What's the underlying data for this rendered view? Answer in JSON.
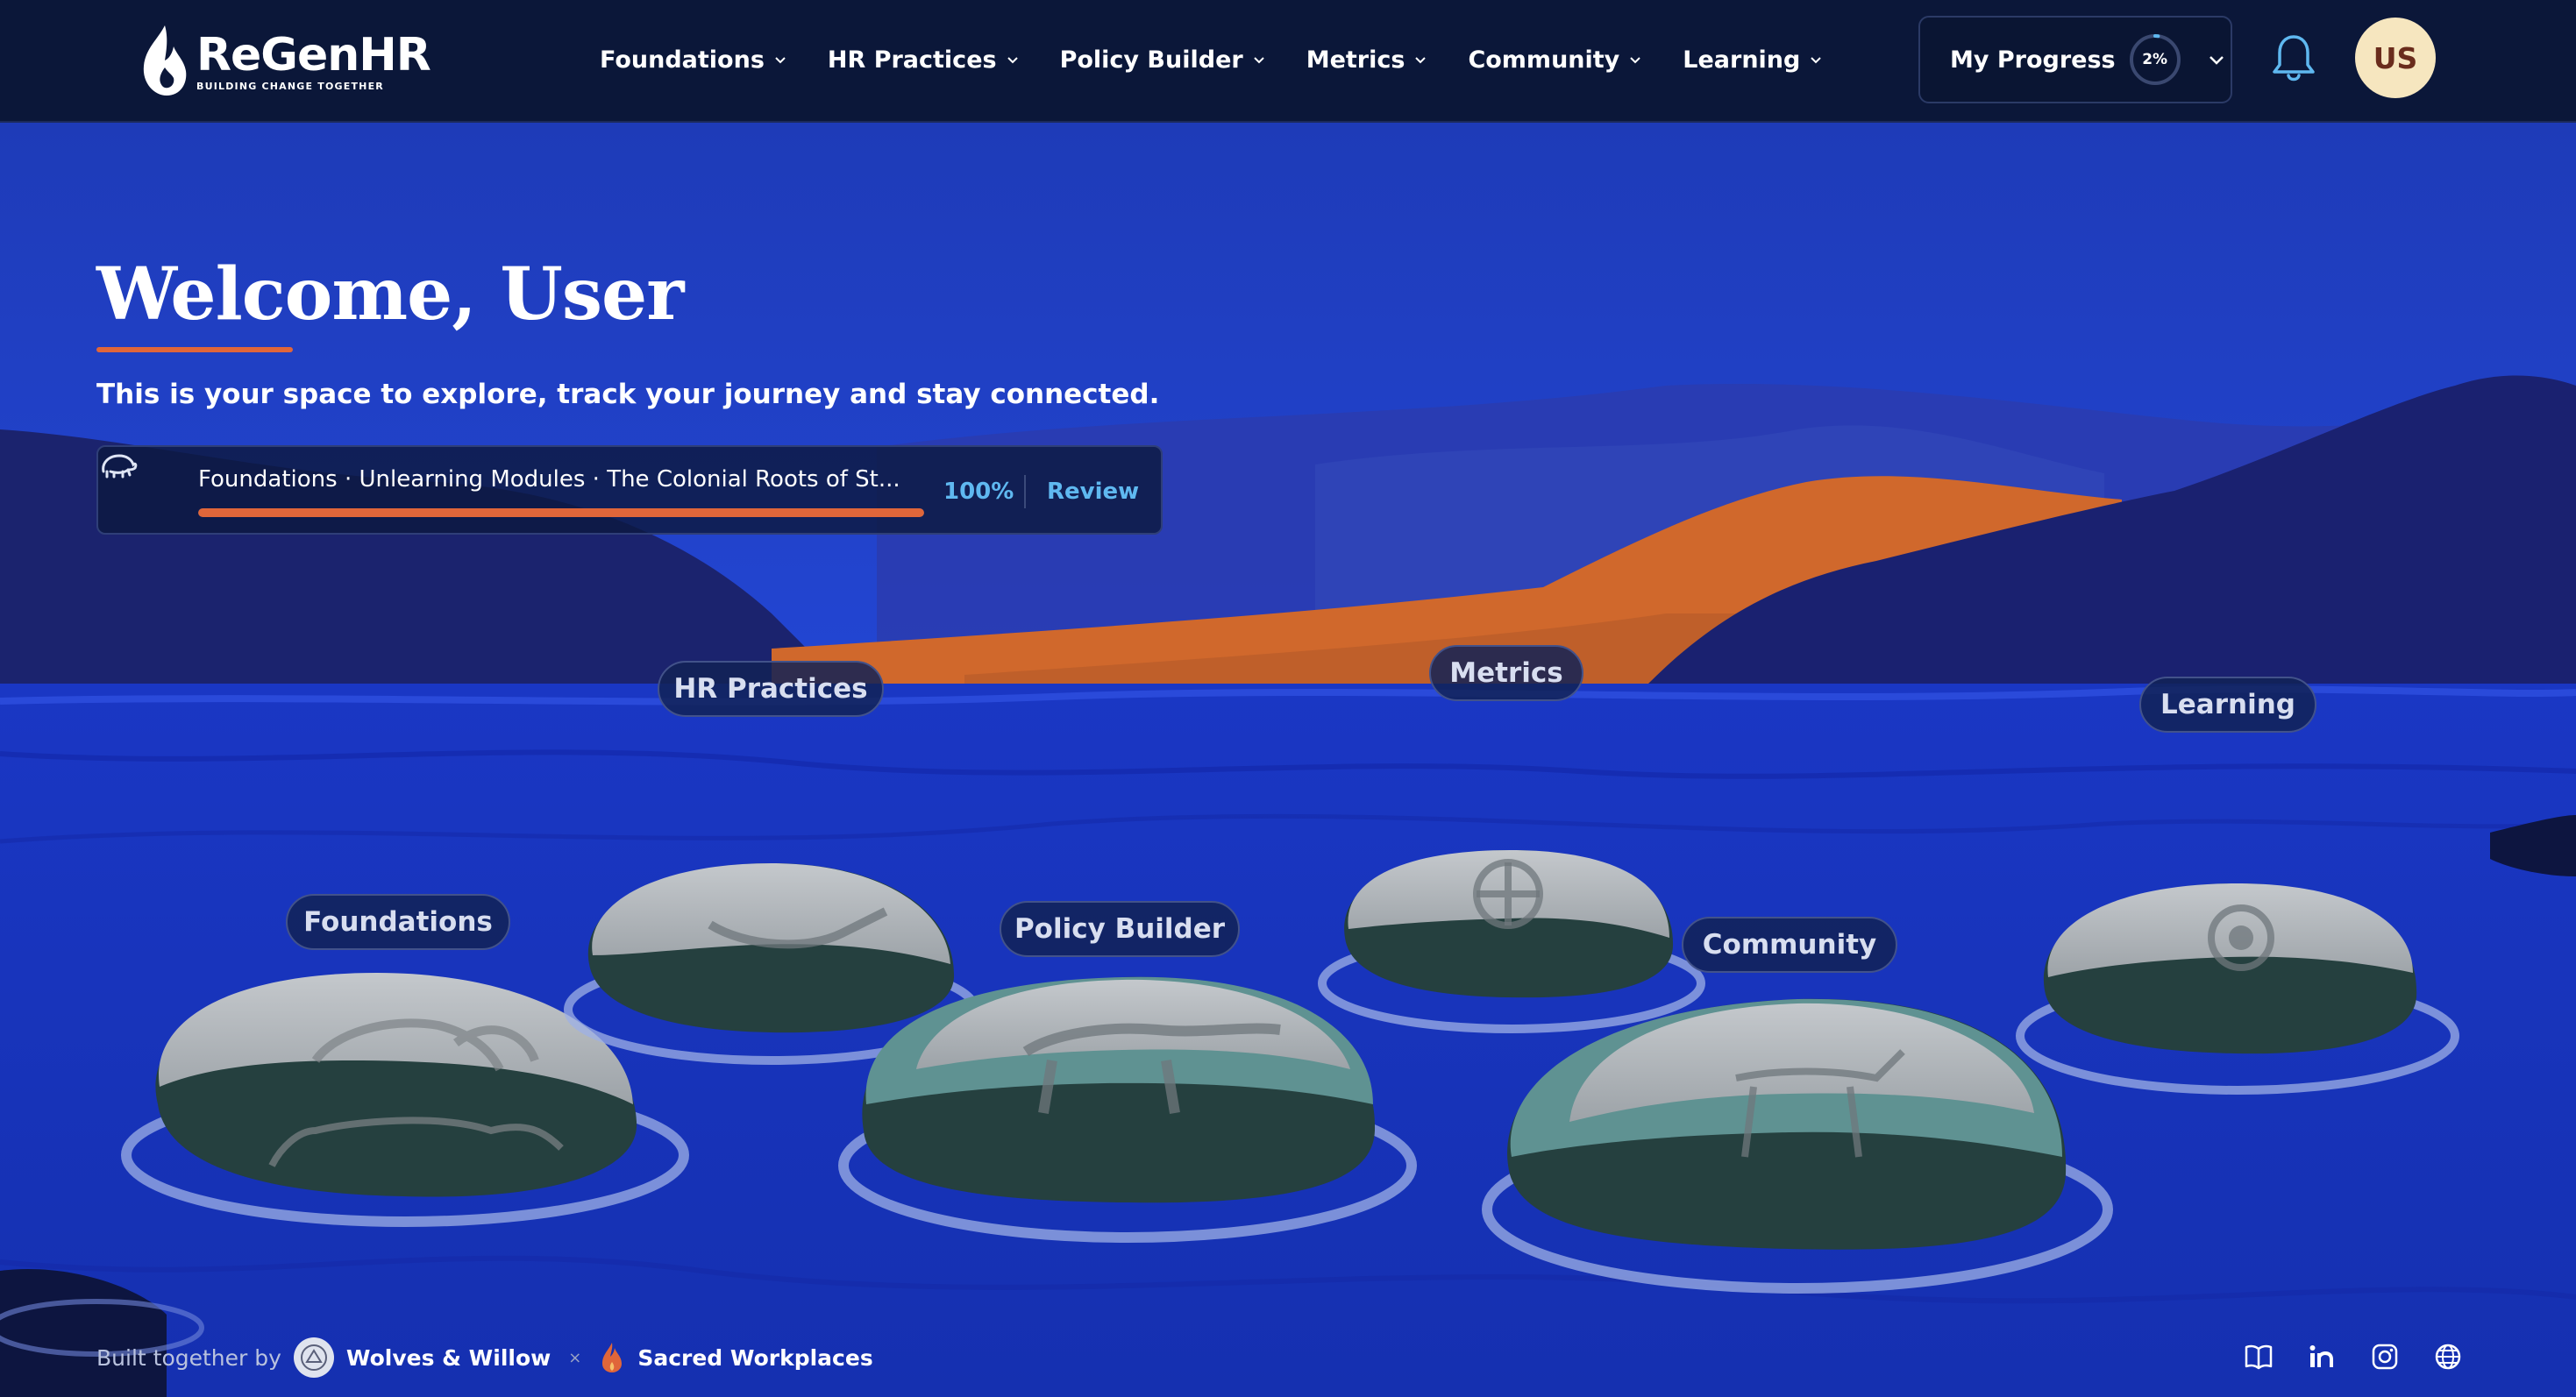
{
  "header": {
    "logo": {
      "name": "ReGenHR",
      "tagline": "BUILDING CHANGE TOGETHER"
    },
    "nav": [
      {
        "label": "Foundations"
      },
      {
        "label": "HR Practices"
      },
      {
        "label": "Policy Builder"
      },
      {
        "label": "Metrics"
      },
      {
        "label": "Community"
      },
      {
        "label": "Learning"
      }
    ],
    "progress": {
      "label": "My Progress",
      "percent_text": "2%",
      "value": 0.02
    },
    "avatar_initials": "US",
    "icons": {
      "notifications": "bell-icon",
      "dropdown": "chevron-down-icon"
    }
  },
  "hero": {
    "title": "Welcome, User",
    "subtitle": "This is your space to explore, track your journey and stay connected."
  },
  "resume": {
    "text": "Foundations · Unlearning Modules · The Colonial Roots of St...",
    "percent_text": "100%",
    "value": 1.0,
    "action": "Review",
    "icon": "bison-petroglyph-icon"
  },
  "stones": [
    {
      "label": "Foundations",
      "glyph": "bison-petroglyph"
    },
    {
      "label": "HR Practices",
      "glyph": "fish-petroglyph"
    },
    {
      "label": "Policy Builder",
      "glyph": "wolf-petroglyph"
    },
    {
      "label": "Metrics",
      "glyph": "medicine-wheel-petroglyph"
    },
    {
      "label": "Community",
      "glyph": "caribou-petroglyph"
    },
    {
      "label": "Learning",
      "glyph": "sun-petroglyph"
    }
  ],
  "footer": {
    "built_by": "Built together by",
    "partners": [
      "Wolves & Willow",
      "Sacred Workplaces"
    ],
    "separator": "×",
    "icons": [
      "book-icon",
      "linkedin-icon",
      "instagram-icon",
      "globe-icon"
    ]
  },
  "colors": {
    "nav_bg": "#0b1739",
    "water": "#1a3bd0",
    "sky": "#1f3fc6",
    "accent_orange": "#e0663a",
    "link_blue": "#5fb8f0",
    "stone_light": "#b3b8bd",
    "stone_teal": "#5f9292",
    "stone_dark": "#25403f"
  }
}
